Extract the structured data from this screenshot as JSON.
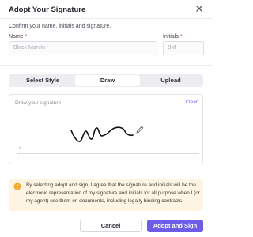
{
  "dialog": {
    "title": "Adopt Your Signature",
    "subtitle": "Confirm your name, initials and signature."
  },
  "form": {
    "name_label": "Name",
    "name_value": "Black Marvin",
    "initials_label": "Initials",
    "initials_value": "BM",
    "required_mark": "*"
  },
  "tabs": [
    {
      "label": "Select Style",
      "active": false
    },
    {
      "label": "Draw",
      "active": true
    },
    {
      "label": "Upload",
      "active": false
    }
  ],
  "signature_pad": {
    "placeholder": "Draw your signature",
    "clear_label": "Clear",
    "baseline_mark": "×",
    "has_drawing": true
  },
  "notice": {
    "text": "By selecting adopt and sign, I agree that the signature and initials will be the electronic representation of my signature and initials for all purpose when I (or my agent) use them on documents, including legally binding contracts."
  },
  "buttons": {
    "cancel": "Cancel",
    "adopt": "Adopt and Sign"
  },
  "colors": {
    "accent": "#6c5ce7",
    "notice_bg": "#fdf4e3",
    "notice_icon": "#f0a830",
    "required": "#e2524b"
  },
  "icons": {
    "close": "close-icon",
    "pencil": "pencil-icon",
    "info": "info-icon"
  }
}
